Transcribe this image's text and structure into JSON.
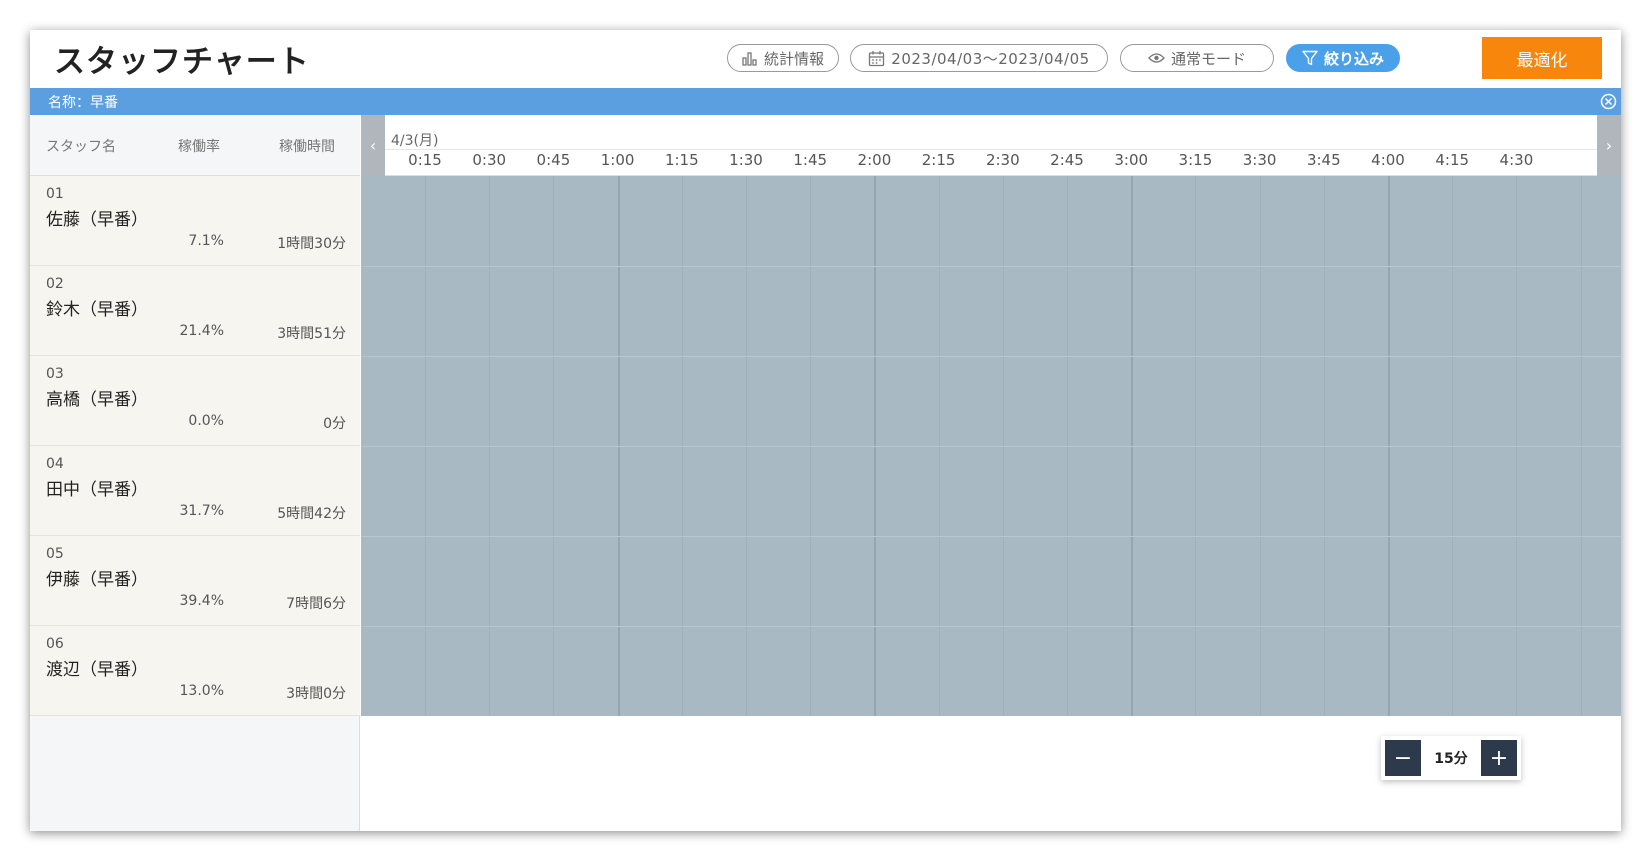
{
  "header": {
    "title": "スタッフチャート",
    "stats_label": "統計情報",
    "date_range": "2023/04/03〜2023/04/05",
    "mode_label": "通常モード",
    "filter_label": "絞り込み",
    "optimize_label": "最適化"
  },
  "name_bar": {
    "label": "名称：早番"
  },
  "columns": {
    "staff": "スタッフ名",
    "rate": "稼働率",
    "hours": "稼働時間"
  },
  "staff": [
    {
      "no": "01",
      "name": "佐藤（早番）",
      "rate": "7.1%",
      "hours": "1時間30分"
    },
    {
      "no": "02",
      "name": "鈴木（早番）",
      "rate": "21.4%",
      "hours": "3時間51分"
    },
    {
      "no": "03",
      "name": "高橋（早番）",
      "rate": "0.0%",
      "hours": "0分"
    },
    {
      "no": "04",
      "name": "田中（早番）",
      "rate": "31.7%",
      "hours": "5時間42分"
    },
    {
      "no": "05",
      "name": "伊藤（早番）",
      "rate": "39.4%",
      "hours": "7時間6分"
    },
    {
      "no": "06",
      "name": "渡辺（早番）",
      "rate": "13.0%",
      "hours": "3時間0分"
    }
  ],
  "timeline": {
    "date": "4/3(月)",
    "ticks": [
      "0:15",
      "0:30",
      "0:45",
      "1:00",
      "1:15",
      "1:30",
      "1:45",
      "2:00",
      "2:15",
      "2:30",
      "2:45",
      "3:00",
      "3:15",
      "3:30",
      "3:45",
      "4:00",
      "4:15",
      "4:30"
    ],
    "prev": "‹",
    "next": "›"
  },
  "zoom": {
    "minus": "−",
    "value": "15分",
    "plus": "+"
  },
  "colors": {
    "accent": "#f7860c",
    "name_bar": "#5b9fe0",
    "filter": "#4ba0ea",
    "grid": "#a8b9c4"
  }
}
